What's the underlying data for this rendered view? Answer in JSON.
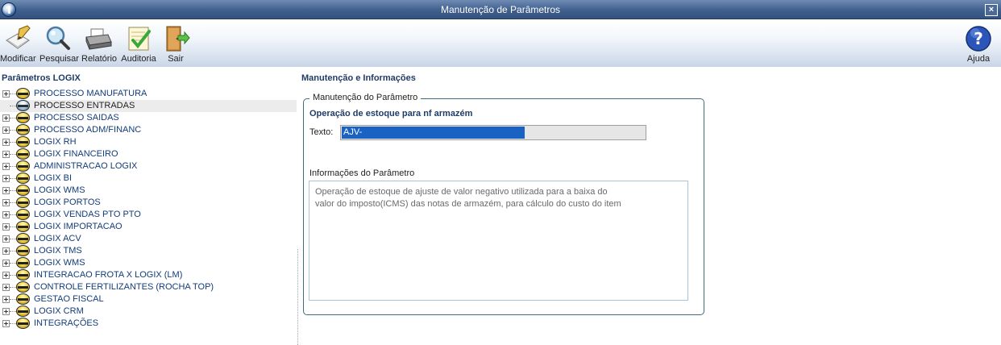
{
  "window": {
    "title": "Manutenção de Parâmetros"
  },
  "toolbar": {
    "modificar": "Modificar",
    "pesquisar": "Pesquisar",
    "relatorio": "Relatório",
    "auditoria": "Auditoria",
    "sair": "Sair",
    "ajuda": "Ajuda"
  },
  "left_panel": {
    "title": "Parâmetros LOGIX",
    "items": [
      {
        "label": "PROCESSO MANUFATURA",
        "selected": false
      },
      {
        "label": "PROCESSO ENTRADAS",
        "selected": true
      },
      {
        "label": "PROCESSO SAIDAS",
        "selected": false
      },
      {
        "label": "PROCESSO ADM/FINANC",
        "selected": false
      },
      {
        "label": "LOGIX RH",
        "selected": false
      },
      {
        "label": "LOGIX FINANCEIRO",
        "selected": false
      },
      {
        "label": "ADMINISTRACAO LOGIX",
        "selected": false
      },
      {
        "label": "LOGIX BI",
        "selected": false
      },
      {
        "label": "LOGIX WMS",
        "selected": false
      },
      {
        "label": "LOGIX PORTOS",
        "selected": false
      },
      {
        "label": "LOGIX VENDAS PTO PTO",
        "selected": false
      },
      {
        "label": "LOGIX IMPORTACAO",
        "selected": false
      },
      {
        "label": "LOGIX ACV",
        "selected": false
      },
      {
        "label": "LOGIX TMS",
        "selected": false
      },
      {
        "label": "LOGIX WMS",
        "selected": false
      },
      {
        "label": "INTEGRACAO FROTA X LOGIX (LM)",
        "selected": false
      },
      {
        "label": "CONTROLE FERTILIZANTES (ROCHA TOP)",
        "selected": false
      },
      {
        "label": "GESTAO FISCAL",
        "selected": false
      },
      {
        "label": "LOGIX CRM",
        "selected": false
      },
      {
        "label": "INTEGRAÇÕES",
        "selected": false
      }
    ]
  },
  "right_panel": {
    "title": "Manutenção e Informações",
    "group_title": "Manutenção do Parâmetro",
    "param_name": "Operação de estoque para nf armazém",
    "texto_label": "Texto:",
    "texto_value": "AJV-",
    "info_label": "Informações do Parâmetro",
    "info_line1": "Operação de estoque de ajuste de valor negativo utilizada para a baixa do",
    "info_line2": "valor do imposto(ICMS) das notas de armazém, para cálculo do custo do item"
  }
}
